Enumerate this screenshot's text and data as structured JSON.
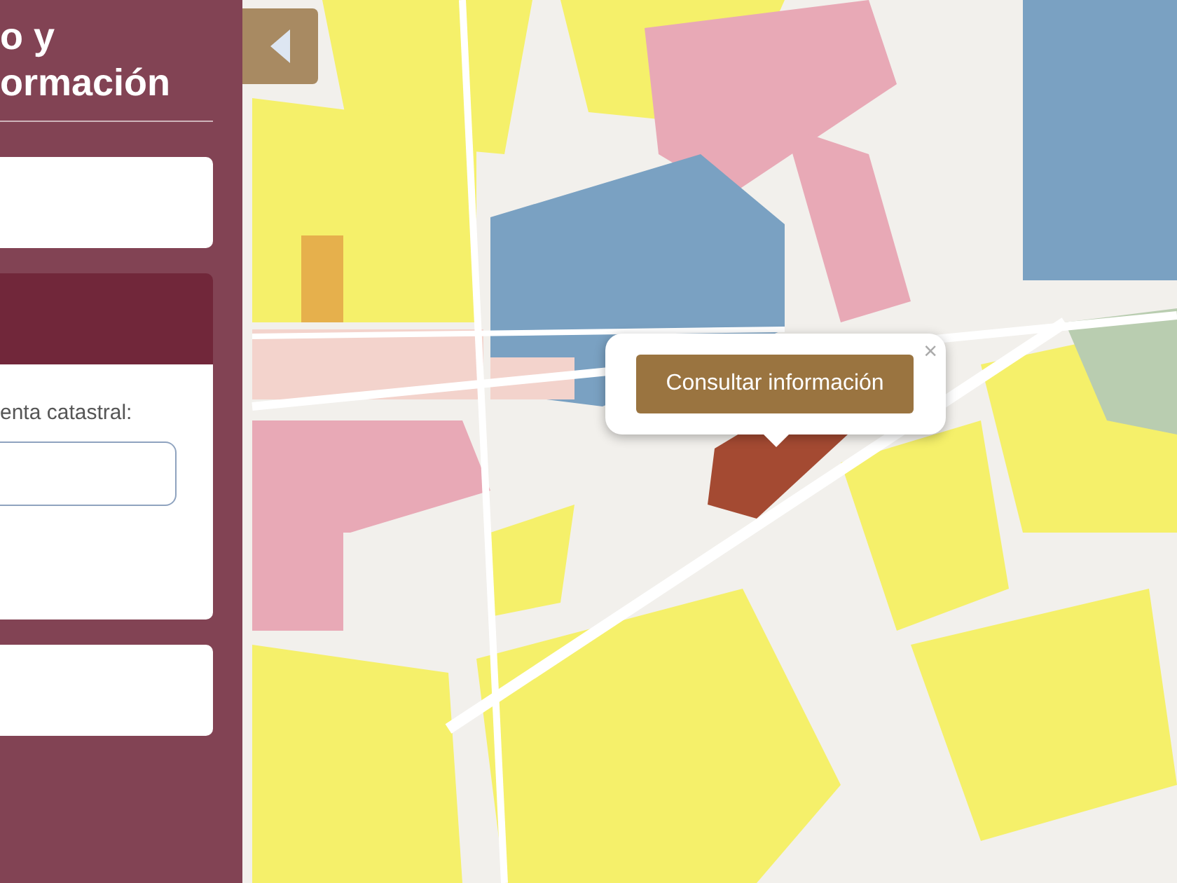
{
  "sidebar": {
    "title_lines": [
      "o y",
      "ormación"
    ],
    "search_panel": {
      "label": "enta catastral:"
    },
    "collapse_button": {
      "expanded": true
    }
  },
  "popup": {
    "close": "×",
    "button": "Consultar información"
  }
}
